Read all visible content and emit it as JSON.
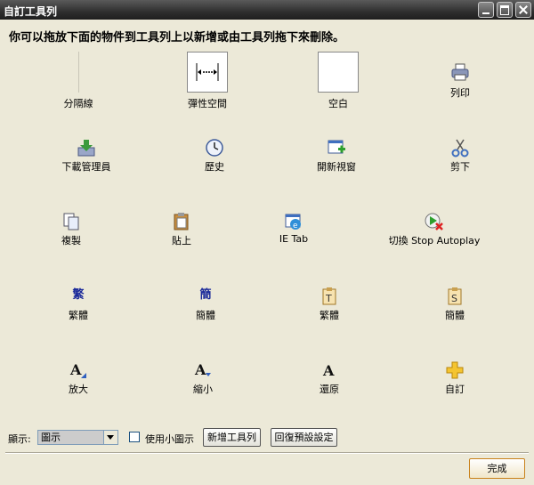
{
  "window": {
    "title": "自訂工具列"
  },
  "instruction": "你可以拖放下面的物件到工具列上以新增或由工具列拖下來刪除。",
  "items": [
    {
      "label": "分隔線",
      "icon": "separator-icon"
    },
    {
      "label": "彈性空間",
      "icon": "flexible-space-icon"
    },
    {
      "label": "空白",
      "icon": "space-icon"
    },
    {
      "label": "列印",
      "icon": "printer-icon"
    },
    {
      "label": "下載管理員",
      "icon": "download-manager-icon"
    },
    {
      "label": "歷史",
      "icon": "history-clock-icon"
    },
    {
      "label": "開新視窗",
      "icon": "new-window-icon"
    },
    {
      "label": "剪下",
      "icon": "scissors-icon"
    },
    {
      "label": "複製",
      "icon": "copy-icon"
    },
    {
      "label": "貼上",
      "icon": "paste-icon"
    },
    {
      "label": "IE Tab",
      "icon": "ie-tab-icon"
    },
    {
      "label": "切換 Stop Autoplay",
      "icon": "stop-autoplay-icon"
    },
    {
      "label": "繁體",
      "icon": "traditional-text-icon",
      "glyph": "繁"
    },
    {
      "label": "簡體",
      "icon": "simplified-text-icon",
      "glyph": "簡"
    },
    {
      "label": "繁體",
      "icon": "traditional-doc-icon",
      "glyph": "T"
    },
    {
      "label": "簡體",
      "icon": "simplified-doc-icon",
      "glyph": "S"
    },
    {
      "label": "放大",
      "icon": "zoom-in-text-icon",
      "glyph": "A"
    },
    {
      "label": "縮小",
      "icon": "zoom-out-text-icon",
      "glyph": "A"
    },
    {
      "label": "還原",
      "icon": "zoom-reset-text-icon",
      "glyph": "A"
    },
    {
      "label": "自訂",
      "icon": "customize-plus-icon"
    }
  ],
  "bottom": {
    "show_label": "顯示:",
    "show_select_value": "圖示",
    "small_icons_label": "使用小圖示",
    "small_icons_checked": false,
    "add_toolbar_button": "新增工具列",
    "restore_defaults_button": "回復預設設定"
  },
  "done_button": "完成"
}
